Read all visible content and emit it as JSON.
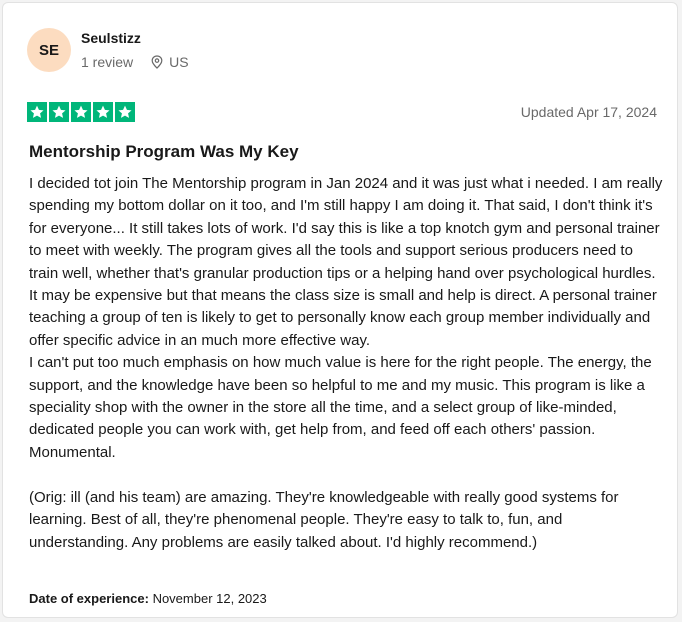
{
  "reviewer": {
    "initials": "SE",
    "name": "Seulstizz",
    "review_count": "1 review",
    "location": "US"
  },
  "review": {
    "rating": 5,
    "rating_max": 5,
    "updated": "Updated Apr 17, 2024",
    "title": "Mentorship Program Was My Key",
    "body": "I decided tot join The Mentorship program in Jan 2024 and it was just what i needed. I am really spending my bottom dollar on it too, and I'm still happy I am doing it. That said, I don't think it's for everyone... It still takes lots of work. I'd say this is like a top knotch gym and personal trainer to meet with weekly. The program gives all the tools and support serious producers need to train well, whether that's granular production tips or a helping hand over psychological hurdles. It may be expensive but that means the class size is small and help is direct. A personal trainer teaching a group of ten is likely to get to personally know each group member individually and offer specific advice in an much more effective way.\nI can't put too much emphasis on how much value is here for the right people. The energy, the support, and the knowledge have been so helpful to me and my music. This program is like a speciality shop with the owner in the store all the time, and a select group of like-minded, dedicated people you can work with, get help from, and feed off each others' passion. Monumental.\n\n(Orig: ill (and his team) are amazing. They're knowledgeable with really good systems for learning. Best of all, they're phenomenal people. They're easy to talk to, fun, and understanding. Any problems are easily talked about. I'd highly recommend.)",
    "date_label": "Date of experience:",
    "date_value": "November 12, 2023"
  },
  "icons": {
    "location": "map-pin-icon",
    "star": "star-icon"
  },
  "colors": {
    "star_green": "#00b67a",
    "avatar_bg": "#fcdcc0",
    "muted_text": "#696969"
  }
}
